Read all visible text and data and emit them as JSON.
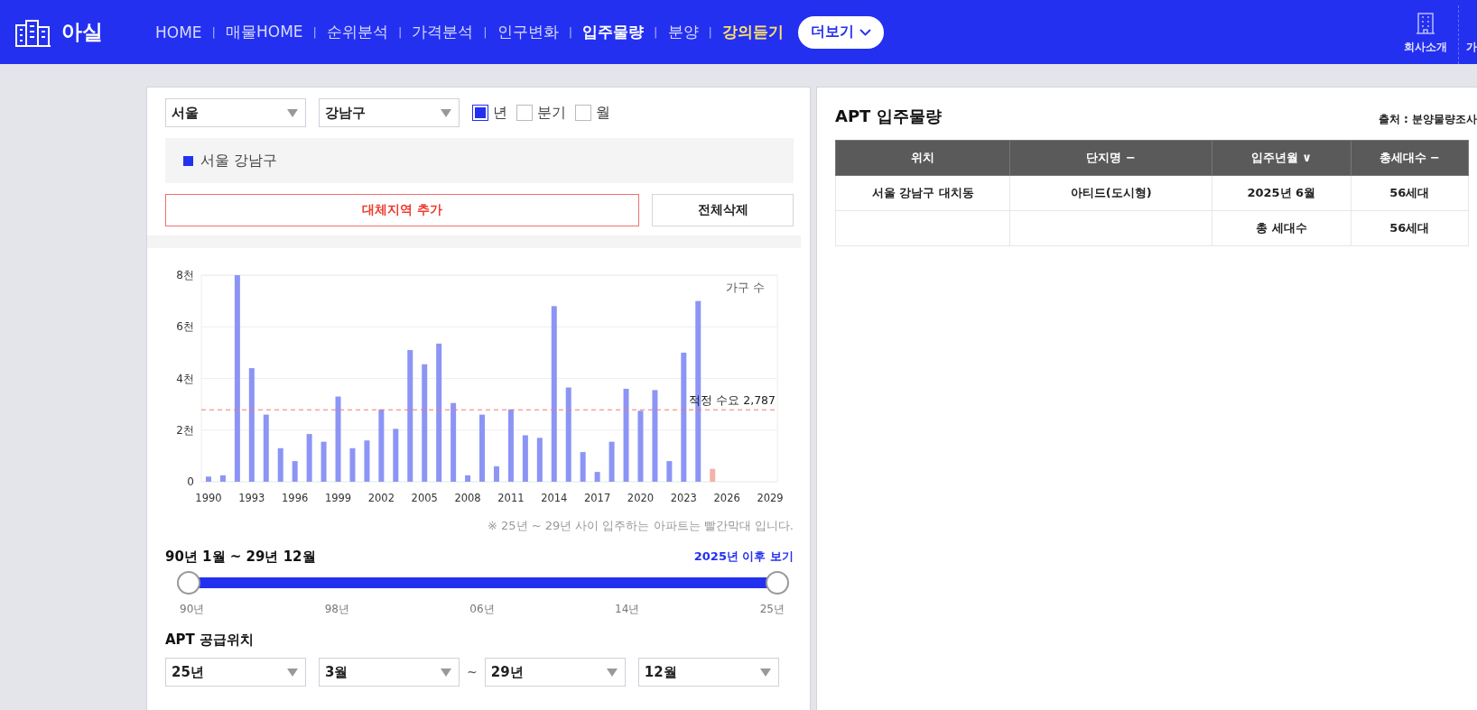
{
  "header": {
    "logo": "아실",
    "nav": [
      {
        "label": "HOME",
        "kind": "normal"
      },
      {
        "label": "매물HOME",
        "kind": "normal"
      },
      {
        "label": "순위분석",
        "kind": "normal"
      },
      {
        "label": "가격분석",
        "kind": "normal"
      },
      {
        "label": "인구변화",
        "kind": "normal"
      },
      {
        "label": "입주물량",
        "kind": "active"
      },
      {
        "label": "분양",
        "kind": "normal"
      },
      {
        "label": "강의듣기",
        "kind": "highlight"
      }
    ],
    "separator": "|",
    "more_button": "더보기",
    "right_links": [
      "회사소개",
      "가"
    ]
  },
  "filters": {
    "city": "서울",
    "district": "강남구",
    "periods": [
      {
        "label": "년",
        "checked": true
      },
      {
        "label": "분기",
        "checked": false
      },
      {
        "label": "월",
        "checked": false
      }
    ]
  },
  "region_tags": [
    {
      "label": "서울 강남구",
      "color": "#2233ee"
    }
  ],
  "add_region_button": "대체지역 추가",
  "delete_all_button": "전체삭제",
  "chart": {
    "chart_data": {
      "type": "bar",
      "stacked": true,
      "categories": [
        "1990",
        null,
        null,
        "1993",
        null,
        null,
        "1996",
        null,
        null,
        "1999",
        null,
        null,
        "2002",
        null,
        null,
        "2005",
        null,
        null,
        "2008",
        null,
        null,
        "2011",
        null,
        null,
        "2014",
        null,
        null,
        "2017",
        null,
        null,
        "2020",
        null,
        null,
        "2023",
        null,
        null,
        "2026",
        null,
        null,
        "2029"
      ],
      "series": [
        {
          "name": "가구 수",
          "color": "#8c95f5",
          "values": [
            0.2,
            0.25,
            8,
            4.4,
            2.6,
            1.3,
            0.8,
            1.85,
            1.55,
            3.3,
            1.3,
            1.6,
            2.8,
            2.05,
            5.1,
            4.55,
            5.35,
            3.05,
            0.25,
            2.6,
            0.6,
            2.8,
            1.8,
            1.7,
            6.8,
            3.65,
            1.15,
            0.38,
            1.55,
            3.6,
            2.75,
            3.55,
            0.8,
            5,
            7,
            null,
            null,
            null,
            null,
            null
          ]
        },
        {
          "color": "#f5b2a8",
          "values": [
            null,
            null,
            null,
            null,
            null,
            null,
            null,
            null,
            null,
            null,
            null,
            null,
            null,
            null,
            null,
            null,
            null,
            null,
            null,
            null,
            null,
            null,
            null,
            null,
            null,
            null,
            null,
            null,
            null,
            null,
            null,
            null,
            null,
            null,
            null,
            0.5,
            null,
            null,
            null,
            null
          ]
        }
      ],
      "ylim": [
        0,
        8
      ],
      "yticks": [
        {
          "value": 0,
          "label": "0"
        },
        {
          "value": 2,
          "label": "2천"
        },
        {
          "value": 4,
          "label": "4천"
        },
        {
          "value": 6,
          "label": "6천"
        },
        {
          "value": 8,
          "label": "8천"
        }
      ],
      "grid": true,
      "ref_lines": [
        {
          "axis": "y",
          "value": 2.787,
          "label": "적정 수요 2,787",
          "color": "#f07a6e"
        }
      ]
    },
    "note": "※ 25년 ~ 29년 사이 입주하는 아파트는 빨간막대 입니다."
  },
  "range": {
    "title": "90년 1월 ~ 29년 12월",
    "link": "2025년 이후 보기",
    "thumbs": [
      {
        "level": 0
      },
      {
        "level": 1
      }
    ],
    "ticks": [
      "90년",
      "98년",
      "06년",
      "14년",
      "25년"
    ]
  },
  "supply": {
    "title": "APT 공급위치",
    "from_year": "25년",
    "from_month": "3월",
    "separator": "~",
    "to_year": "29년",
    "to_month": "12월"
  },
  "table": {
    "title": "APT 입주물량",
    "source": "출처 : 분양물량조사",
    "columns": [
      {
        "label": "위치"
      },
      {
        "label": "단지명",
        "sort": "−"
      },
      {
        "label": "입주년월",
        "sort": "∨"
      },
      {
        "label": "총세대수",
        "sort": "−"
      }
    ],
    "rows": [
      [
        "서울 강남구 대치동",
        "아티드(도시형)",
        "2025년 6월",
        "56세대"
      ],
      [
        "",
        "",
        "총 세대수",
        "56세대"
      ]
    ]
  }
}
